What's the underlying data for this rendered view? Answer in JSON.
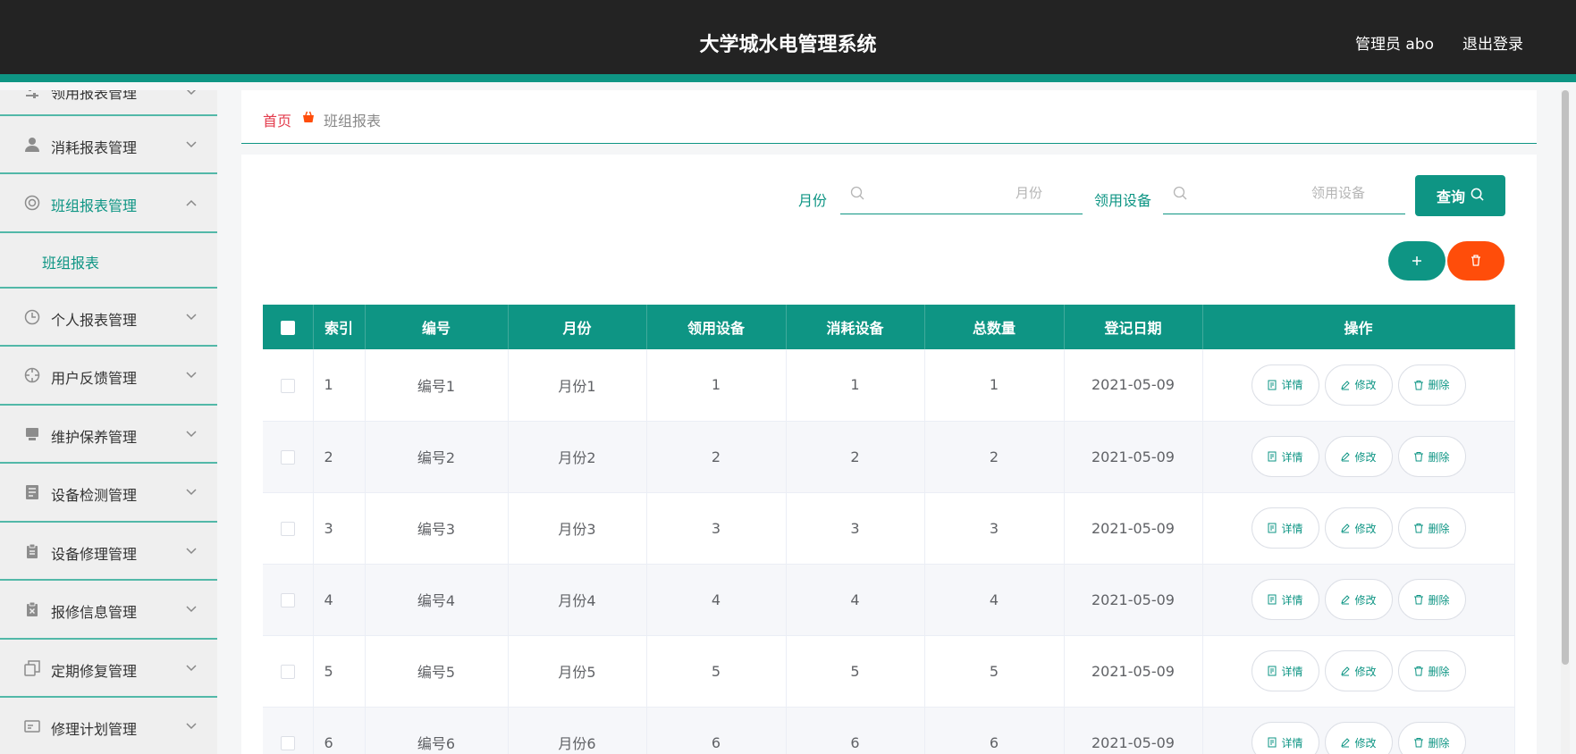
{
  "header": {
    "title": "大学城水电管理系统",
    "user": "管理员 abo",
    "logout": "退出登录"
  },
  "sidebar": {
    "items": [
      {
        "label": "领用报表管理",
        "icon": "slider-icon"
      },
      {
        "label": "消耗报表管理",
        "icon": "person-icon"
      },
      {
        "label": "班组报表管理",
        "icon": "lifebuoy-icon",
        "open": true
      },
      {
        "label": "个人报表管理",
        "icon": "clock-icon"
      },
      {
        "label": "用户反馈管理",
        "icon": "crosshair-icon"
      },
      {
        "label": "维护保养管理",
        "icon": "monitor-icon"
      },
      {
        "label": "设备检测管理",
        "icon": "document-icon"
      },
      {
        "label": "设备修理管理",
        "icon": "clipboard-icon"
      },
      {
        "label": "报修信息管理",
        "icon": "clipboard-x-icon"
      },
      {
        "label": "定期修复管理",
        "icon": "copy-icon"
      },
      {
        "label": "修理计划管理",
        "icon": "card-icon"
      }
    ],
    "sub_item": "班组报表"
  },
  "breadcrumb": {
    "home": "首页",
    "current": "班组报表"
  },
  "search": {
    "month_label": "月份",
    "month_placeholder": "月份",
    "month_value": "",
    "device_label": "领用设备",
    "device_placeholder": "领用设备",
    "device_value": "",
    "query_label": "查询"
  },
  "table": {
    "headers": [
      "索引",
      "编号",
      "月份",
      "领用设备",
      "消耗设备",
      "总数量",
      "登记日期",
      "操作"
    ],
    "rows": [
      [
        "1",
        "编号1",
        "月份1",
        "1",
        "1",
        "1",
        "2021-05-09"
      ],
      [
        "2",
        "编号2",
        "月份2",
        "2",
        "2",
        "2",
        "2021-05-09"
      ],
      [
        "3",
        "编号3",
        "月份3",
        "3",
        "3",
        "3",
        "2021-05-09"
      ],
      [
        "4",
        "编号4",
        "月份4",
        "4",
        "4",
        "4",
        "2021-05-09"
      ],
      [
        "5",
        "编号5",
        "月份5",
        "5",
        "5",
        "5",
        "2021-05-09"
      ],
      [
        "6",
        "编号6",
        "月份6",
        "6",
        "6",
        "6",
        "2021-05-09"
      ]
    ],
    "actions": {
      "detail": "详情",
      "edit": "修改",
      "delete": "删除"
    }
  },
  "colors": {
    "accent": "#0e9584",
    "header_bg": "#232323",
    "danger": "#ff4d0a",
    "home_crumb": "#e33b4c"
  }
}
